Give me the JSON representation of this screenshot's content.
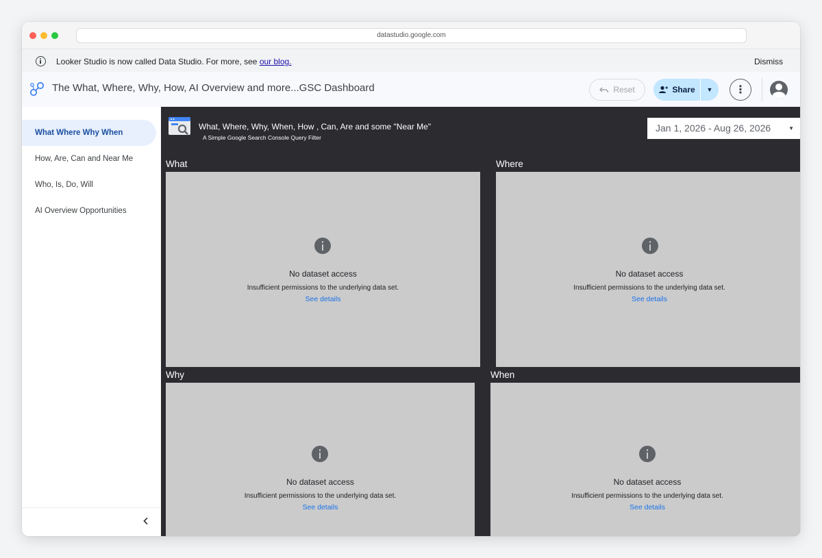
{
  "browser": {
    "url": "datastudio.google.com"
  },
  "banner": {
    "text": "Looker Studio is now called Data Studio. For more, see ",
    "link_text": "our blog.",
    "dismiss_label": "Dismiss"
  },
  "header": {
    "title": "The What, Where, Why, How, AI Overview and more...GSC Dashboard",
    "reset_label": "Reset",
    "share_label": "Share"
  },
  "sidebar": {
    "items": [
      {
        "label": "What Where Why When",
        "active": true
      },
      {
        "label": "How, Are, Can and Near Me",
        "active": false
      },
      {
        "label": "Who, Is, Do, Will",
        "active": false
      },
      {
        "label": "AI Overview Opportunities",
        "active": false
      }
    ]
  },
  "report": {
    "title": "What, Where, Why, When, How , Can, Are and some \"Near Me\"",
    "subtitle": "A Simple Google Search Console Query Filter",
    "date_range": "Jan 1, 2026 - Aug 26, 2026",
    "sections": [
      {
        "label": "What",
        "error_title": "No dataset access",
        "error_desc": "Insufficient permissions to the underlying data set.",
        "link": "See details"
      },
      {
        "label": "Where",
        "error_title": "No dataset access",
        "error_desc": "Insufficient permissions to the underlying data set.",
        "link": "See details"
      },
      {
        "label": "Why",
        "error_title": "No dataset access",
        "error_desc": "Insufficient permissions to the underlying data set.",
        "link": "See details"
      },
      {
        "label": "When",
        "error_title": "No dataset access",
        "error_desc": "Insufficient permissions to the underlying data set.",
        "link": "See details"
      }
    ]
  },
  "colors": {
    "canvas_bg": "#2b2b30",
    "panel_bg": "#cbcbcc",
    "active_nav_bg": "#e8f0fe",
    "share_bg": "#c2e7ff",
    "link": "#1a73e8"
  },
  "icons": {
    "banner": "info-icon",
    "logo": "data-studio-logo-icon",
    "reset": "undo-icon",
    "share": "person-add-icon",
    "more": "more-vert-icon",
    "account": "account-circle-icon",
    "collapse": "chevron-left-icon",
    "panel": "info-filled-icon",
    "report": "search-console-icon"
  }
}
